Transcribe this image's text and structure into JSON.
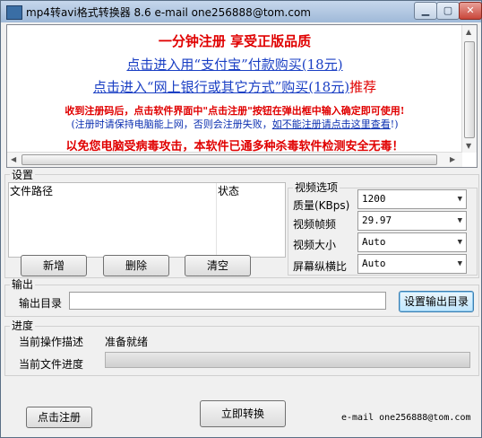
{
  "window": {
    "title": "mp4转avi格式转换器 8.6   e-mail one256888@tom.com"
  },
  "promo": {
    "line1": "一分钟注册  享受正版品质",
    "line2": "点击进入用“支付宝”付款购买(18元)",
    "line3_link": "点击进入“网上银行或其它方式”购买(18元)",
    "line3_suffix": "推荐",
    "line4": "收到注册码后，点击软件界面中\"点击注册\"按钮在弹出框中输入确定即可使用!",
    "line5_pre": "(注册时请保持电脑能上网，否则会注册失败，",
    "line5_link": "如不能注册请点击这里查看",
    "line5_post": "!)",
    "line6": "以免您电脑受病毒攻击，本软件已通多种杀毒软件检测安全无毒！"
  },
  "settings": {
    "group_label": "设置",
    "col_path": "文件路径",
    "col_status": "状态",
    "add_label": "新增",
    "delete_label": "删除",
    "clear_label": "清空"
  },
  "video": {
    "group_label": "视频选项",
    "quality_label": "质量(KBps)",
    "quality_value": "1200",
    "fps_label": "视频帧频",
    "fps_value": "29.97",
    "size_label": "视频大小",
    "size_value": "Auto",
    "aspect_label": "屏幕纵横比",
    "aspect_value": "Auto"
  },
  "output": {
    "group_label": "输出",
    "dir_label": "输出目录",
    "dir_value": "",
    "set_dir_label": "设置输出目录"
  },
  "progress": {
    "group_label": "进度",
    "op_label": "当前操作描述",
    "op_value": "准备就绪",
    "file_label": "当前文件进度",
    "percent": 0
  },
  "footer": {
    "register_label": "点击注册",
    "convert_label": "立即转换",
    "email": "e-mail one256888@tom.com"
  },
  "colors": {
    "promo_red": "#e00000",
    "promo_blue": "#1a3fc4"
  }
}
